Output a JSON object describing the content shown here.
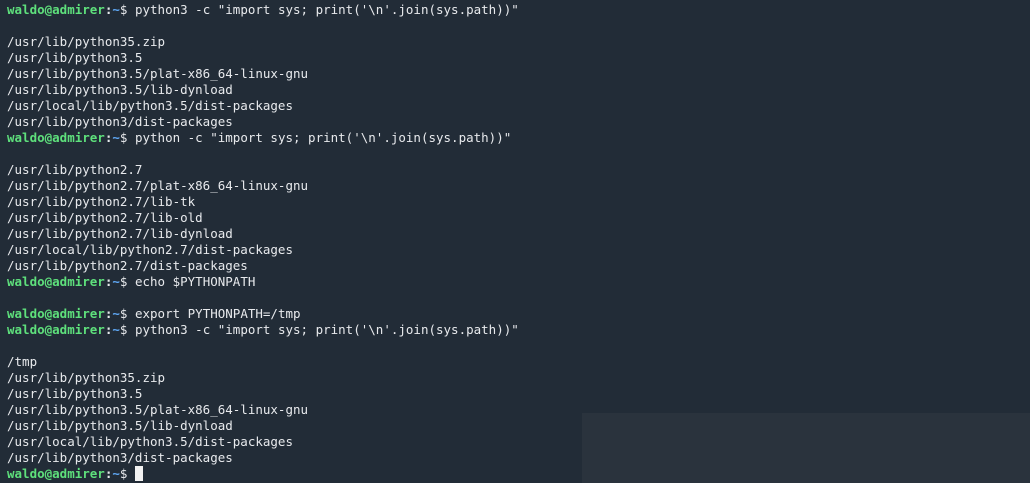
{
  "prompt": {
    "user": "waldo@admirer",
    "separator": ":",
    "path": "~",
    "symbol": "$"
  },
  "commands": {
    "cmd1": "python3 -c \"import sys; print('\\n'.join(sys.path))\"",
    "cmd2": "python -c \"import sys; print('\\n'.join(sys.path))\"",
    "cmd3": "echo $PYTHONPATH",
    "cmd4": "export PYTHONPATH=/tmp",
    "cmd5": "python3 -c \"import sys; print('\\n'.join(sys.path))\""
  },
  "output1": [
    "/usr/lib/python35.zip",
    "/usr/lib/python3.5",
    "/usr/lib/python3.5/plat-x86_64-linux-gnu",
    "/usr/lib/python3.5/lib-dynload",
    "/usr/local/lib/python3.5/dist-packages",
    "/usr/lib/python3/dist-packages"
  ],
  "output2": [
    "/usr/lib/python2.7",
    "/usr/lib/python2.7/plat-x86_64-linux-gnu",
    "/usr/lib/python2.7/lib-tk",
    "/usr/lib/python2.7/lib-old",
    "/usr/lib/python2.7/lib-dynload",
    "/usr/local/lib/python2.7/dist-packages",
    "/usr/lib/python2.7/dist-packages"
  ],
  "output3": [
    "/tmp",
    "/usr/lib/python35.zip",
    "/usr/lib/python3.5",
    "/usr/lib/python3.5/plat-x86_64-linux-gnu",
    "/usr/lib/python3.5/lib-dynload",
    "/usr/local/lib/python3.5/dist-packages",
    "/usr/lib/python3/dist-packages"
  ],
  "colors": {
    "background": "#222c37",
    "user": "#5ee07c",
    "path": "#5fa8f5",
    "text": "#e8eaed"
  }
}
